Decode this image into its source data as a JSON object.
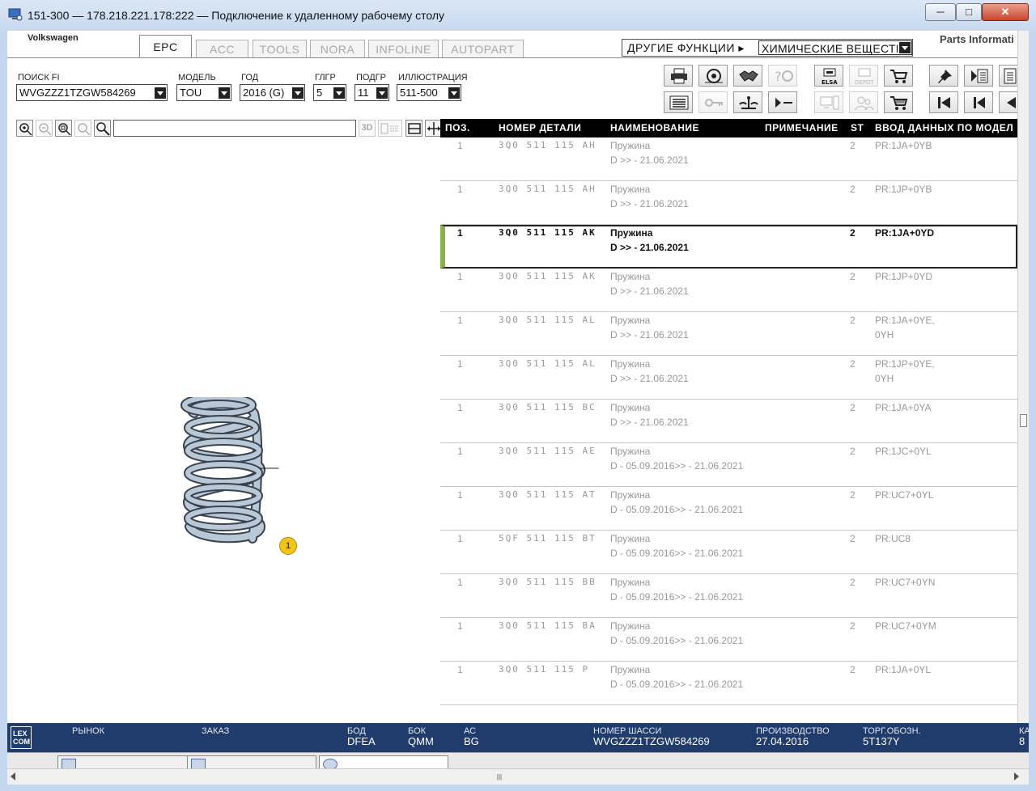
{
  "window": {
    "title": "151-300 — 178.218.221.178:222 — Подключение к удаленному рабочему столу"
  },
  "app": {
    "brand": "Volkswagen",
    "logo_text": "Parts Informati",
    "tabs": [
      {
        "label": "EPC",
        "active": true
      },
      {
        "label": "ACC"
      },
      {
        "label": "TOOLS"
      },
      {
        "label": "NORA"
      },
      {
        "label": "INFOLINE"
      },
      {
        "label": "AUTOPART"
      }
    ],
    "other_functions": {
      "label": "ДРУГИЕ ФУНКЦИИ ▸",
      "selected": "ХИМИЧЕСКИЕ ВЕЩЕСТВА"
    }
  },
  "filters": {
    "search_fi": {
      "label": "ПОИСК FI",
      "value": "WVGZZZ1TZGW584269"
    },
    "model": {
      "label": "МОДЕЛЬ",
      "value": "TOU"
    },
    "year": {
      "label": "ГОД",
      "value": "2016 (G)"
    },
    "main_group": {
      "label": "ГЛГР",
      "value": "5"
    },
    "sub_group": {
      "label": "ПОДГР",
      "value": "11"
    },
    "illustration": {
      "label": "ИЛЛЮСТРАЦИЯ",
      "value": "511-500"
    }
  },
  "toolbar_icons": [
    "printer-icon",
    "parts-wheel-icon",
    "handshake-icon",
    "help-icon",
    "elsa-icon",
    "depot-icon",
    "cart-in-icon",
    "pin-icon",
    "panel-left-icon",
    "document-icon",
    "list-icon",
    "key-icon",
    "scale-icon",
    "play-dash-icon",
    "computer-icon",
    "people-icon",
    "cart-icon",
    "first-icon",
    "prev-icon",
    "back-icon"
  ],
  "toolbar_labels": {
    "elsa": "ELSA",
    "depot": "DEPOT"
  },
  "left_toolbar": {
    "btn_3d": "3D"
  },
  "illustration": {
    "callout": "1"
  },
  "list": {
    "headers": {
      "pos": "ПОЗ.",
      "part_no": "НОМЕР ДЕТАЛИ",
      "name": "НАИМЕНОВАНИЕ",
      "note": "ПРИМЕЧАНИЕ",
      "st": "ST",
      "model_data": "ВВОД ДАННЫХ ПО МОДЕЛ"
    },
    "rows": [
      {
        "pos": "1",
        "part": "3Q0 511 115 AH",
        "name": "Пружина",
        "date": "D           >> - 21.06.2021",
        "st": "2",
        "data": "PR:1JA+0YB",
        "data2": ""
      },
      {
        "pos": "1",
        "part": "3Q0 511 115 AH",
        "name": "Пружина",
        "date": "D           >> - 21.06.2021",
        "st": "2",
        "data": "PR:1JP+0YB",
        "data2": ""
      },
      {
        "pos": "1",
        "part": "3Q0 511 115 AK",
        "name": "Пружина",
        "date": "D           >> - 21.06.2021",
        "st": "2",
        "data": "PR:1JA+0YD",
        "data2": "",
        "selected": true
      },
      {
        "pos": "1",
        "part": "3Q0 511 115 AK",
        "name": "Пружина",
        "date": "D           >> - 21.06.2021",
        "st": "2",
        "data": "PR:1JP+0YD",
        "data2": ""
      },
      {
        "pos": "1",
        "part": "3Q0 511 115 AL",
        "name": "Пружина",
        "date": "D           >> - 21.06.2021",
        "st": "2",
        "data": "PR:1JA+0YE,",
        "data2": "0YH"
      },
      {
        "pos": "1",
        "part": "3Q0 511 115 AL",
        "name": "Пружина",
        "date": "D           >> - 21.06.2021",
        "st": "2",
        "data": "PR:1JP+0YE,",
        "data2": "0YH"
      },
      {
        "pos": "1",
        "part": "3Q0 511 115 BC",
        "name": "Пружина",
        "date": "D           >> - 21.06.2021",
        "st": "2",
        "data": "PR:1JA+0YA",
        "data2": ""
      },
      {
        "pos": "1",
        "part": "3Q0 511 115 AE",
        "name": "Пружина",
        "date": "D - 05.09.2016>> - 21.06.2021",
        "st": "2",
        "data": "PR:1JC+0YL",
        "data2": ""
      },
      {
        "pos": "1",
        "part": "3Q0 511 115 AT",
        "name": "Пружина",
        "date": "D - 05.09.2016>> - 21.06.2021",
        "st": "2",
        "data": "PR:UC7+0YL",
        "data2": ""
      },
      {
        "pos": "1",
        "part": "5QF 511 115 BT",
        "name": "Пружина",
        "date": "D - 05.09.2016>> - 21.06.2021",
        "st": "2",
        "data": "PR:UC8",
        "data2": ""
      },
      {
        "pos": "1",
        "part": "3Q0 511 115 BB",
        "name": "Пружина",
        "date": "D - 05.09.2016>> - 21.06.2021",
        "st": "2",
        "data": "PR:UC7+0YN",
        "data2": ""
      },
      {
        "pos": "1",
        "part": "3Q0 511 115 BA",
        "name": "Пружина",
        "date": "D - 05.09.2016>> - 21.06.2021",
        "st": "2",
        "data": "PR:UC7+0YM",
        "data2": ""
      },
      {
        "pos": "1",
        "part": "3Q0 511 115 P",
        "name": "Пружина",
        "date": "D - 05.09.2016>> - 21.06.2021",
        "st": "2",
        "data": "PR:1JA+0YL",
        "data2": ""
      }
    ]
  },
  "status": {
    "logo": "LEX COM",
    "fields": [
      {
        "label": "РЫНОК",
        "value": ""
      },
      {
        "label": "ЗАКАЗ",
        "value": ""
      },
      {
        "label": "БОД",
        "value": "DFEA"
      },
      {
        "label": "БОК",
        "value": "QMM"
      },
      {
        "label": "АС",
        "value": "BG"
      },
      {
        "label": "НОМЕР ШАССИ",
        "value": "WVGZZZ1TZGW584269"
      },
      {
        "label": "ПРОИЗВОДСТВО",
        "value": "27.04.2016"
      },
      {
        "label": "ТОРГ.ОБОЗН.",
        "value": "5T137Y"
      },
      {
        "label": "КА",
        "value": "8"
      }
    ]
  },
  "hscroll": {
    "thumb": "|||"
  }
}
